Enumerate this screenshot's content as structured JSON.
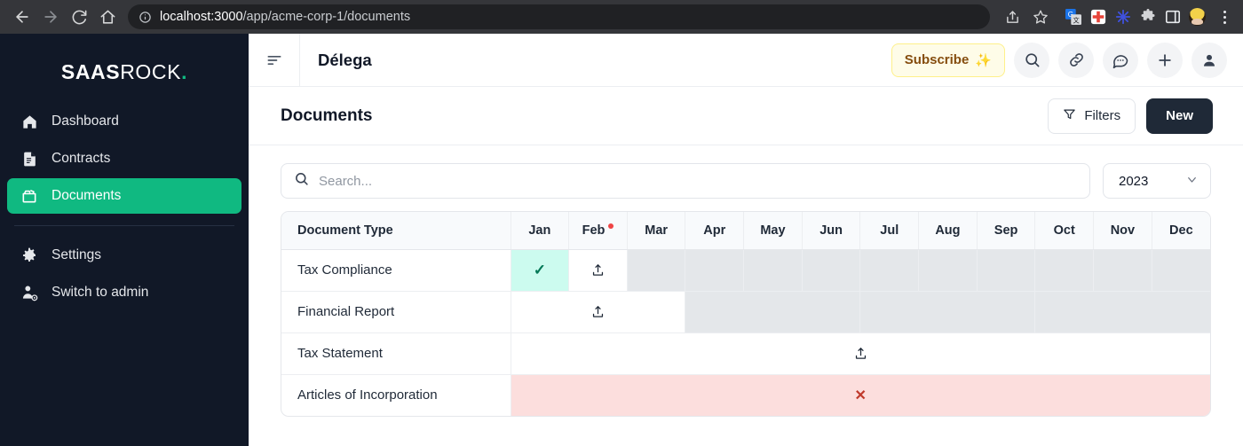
{
  "browser": {
    "url_host": "localhost:3000",
    "url_path": "/app/acme-corp-1/documents",
    "back_icon": "back-arrow-icon",
    "forward_icon": "forward-arrow-icon",
    "reload_icon": "reload-icon",
    "home_icon": "home-icon",
    "info_icon": "site-info-icon",
    "share_icon": "share-icon",
    "bookmark_icon": "star-icon",
    "extensions": [
      "google-translate-icon",
      "medical-cross-icon",
      "asterisk-icon",
      "puzzle-piece-icon",
      "side-panel-icon",
      "profile-avatar-icon"
    ],
    "menu_icon": "three-dot-menu-icon"
  },
  "sidebar": {
    "brand_bold": "SAAS",
    "brand_light": "ROCK",
    "brand_dot": ".",
    "items": [
      {
        "label": "Dashboard",
        "icon": "home-icon",
        "active": false
      },
      {
        "label": "Contracts",
        "icon": "document-icon",
        "active": false
      },
      {
        "label": "Documents",
        "icon": "folder-icon",
        "active": true
      },
      {
        "label": "Settings",
        "icon": "gear-icon",
        "active": false
      },
      {
        "label": "Switch to admin",
        "icon": "user-switch-icon",
        "active": false
      }
    ]
  },
  "topbar": {
    "menu_icon": "collapse-menu-icon",
    "app_title": "Délega",
    "subscribe_label": "Subscribe",
    "subscribe_emoji": "✨",
    "actions": [
      {
        "name": "search-icon"
      },
      {
        "name": "link-icon"
      },
      {
        "name": "chat-icon"
      },
      {
        "name": "plus-icon"
      },
      {
        "name": "account-icon"
      }
    ]
  },
  "page": {
    "title": "Documents",
    "filters_label": "Filters",
    "filters_icon": "filter-funnel-icon",
    "new_label": "New"
  },
  "search": {
    "placeholder": "Search...",
    "value": "",
    "icon": "search-icon"
  },
  "year_select": {
    "value": "2023",
    "icon": "chevron-down-icon"
  },
  "table": {
    "first_column_header": "Document Type",
    "months": [
      {
        "label": "Jan",
        "alert": false
      },
      {
        "label": "Feb",
        "alert": true
      },
      {
        "label": "Mar",
        "alert": false
      },
      {
        "label": "Apr",
        "alert": false
      },
      {
        "label": "May",
        "alert": false
      },
      {
        "label": "Jun",
        "alert": false
      },
      {
        "label": "Jul",
        "alert": false
      },
      {
        "label": "Aug",
        "alert": false
      },
      {
        "label": "Sep",
        "alert": false
      },
      {
        "label": "Oct",
        "alert": false
      },
      {
        "label": "Nov",
        "alert": false
      },
      {
        "label": "Dec",
        "alert": false
      }
    ],
    "rows": [
      {
        "name": "Tax Compliance",
        "cells": [
          {
            "span": 1,
            "state": "complete",
            "content": "✓"
          },
          {
            "span": 1,
            "state": "upload",
            "content": "upload-icon"
          },
          {
            "span": 1,
            "state": "disabled",
            "content": ""
          },
          {
            "span": 1,
            "state": "disabled",
            "content": ""
          },
          {
            "span": 1,
            "state": "disabled",
            "content": ""
          },
          {
            "span": 1,
            "state": "disabled",
            "content": ""
          },
          {
            "span": 1,
            "state": "disabled",
            "content": ""
          },
          {
            "span": 1,
            "state": "disabled",
            "content": ""
          },
          {
            "span": 1,
            "state": "disabled",
            "content": ""
          },
          {
            "span": 1,
            "state": "disabled",
            "content": ""
          },
          {
            "span": 1,
            "state": "disabled",
            "content": ""
          },
          {
            "span": 1,
            "state": "disabled",
            "content": ""
          }
        ]
      },
      {
        "name": "Financial Report",
        "cells": [
          {
            "span": 3,
            "state": "upload",
            "content": "upload-icon"
          },
          {
            "span": 3,
            "state": "disabled",
            "content": ""
          },
          {
            "span": 3,
            "state": "disabled",
            "content": ""
          },
          {
            "span": 3,
            "state": "disabled",
            "content": ""
          }
        ]
      },
      {
        "name": "Tax Statement",
        "cells": [
          {
            "span": 12,
            "state": "upload",
            "content": "upload-icon"
          }
        ]
      },
      {
        "name": "Articles of Incorporation",
        "cells": [
          {
            "span": 12,
            "state": "error",
            "content": "✕"
          }
        ]
      }
    ]
  }
}
